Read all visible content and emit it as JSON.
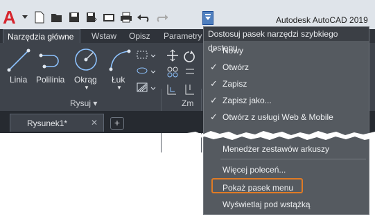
{
  "app": {
    "title": "Autodesk AutoCAD 2019",
    "logo": "A"
  },
  "qat": {
    "icons": [
      "new-icon",
      "open-icon",
      "save-icon",
      "save-as-icon",
      "web-mobile-icon",
      "print-icon",
      "undo-icon",
      "redo-icon"
    ],
    "dropdown_icon": "customize-dropdown-icon"
  },
  "ribbon": {
    "tabs": [
      "Narzędzia główne",
      "Wstaw",
      "Opisz",
      "Parametry"
    ],
    "tools": {
      "line": "Linia",
      "polyline": "Polilinia",
      "circle": "Okrąg",
      "arc": "Łuk"
    },
    "panel_draw": "Rysuj ▾",
    "panel_modify": "Zm"
  },
  "document": {
    "tab": "Rysunek1*",
    "close": "✕",
    "add": "+"
  },
  "menu": {
    "header": "Dostosuj pasek narzędzi szybkiego dostępu",
    "items": [
      {
        "label": "Nowy",
        "checked": "✓"
      },
      {
        "label": "Otwórz",
        "checked": "✓"
      },
      {
        "label": "Zapisz",
        "checked": "✓"
      },
      {
        "label": "Zapisz jako...",
        "checked": "✓"
      },
      {
        "label": "Otwórz z usługi Web & Mobile",
        "checked": "✓"
      },
      {
        "label": "Menedżer zestawów arkuszy",
        "checked": ""
      },
      {
        "label": "Więcej poleceń...",
        "checked": ""
      },
      {
        "label": "Pokaż pasek menu",
        "checked": ""
      },
      {
        "label": "Wyświetlaj pod wstążką",
        "checked": ""
      }
    ]
  },
  "colors": {
    "accent": "#e07b25",
    "menu_bg": "#555a60",
    "ribbon_bg": "#3e434b"
  }
}
